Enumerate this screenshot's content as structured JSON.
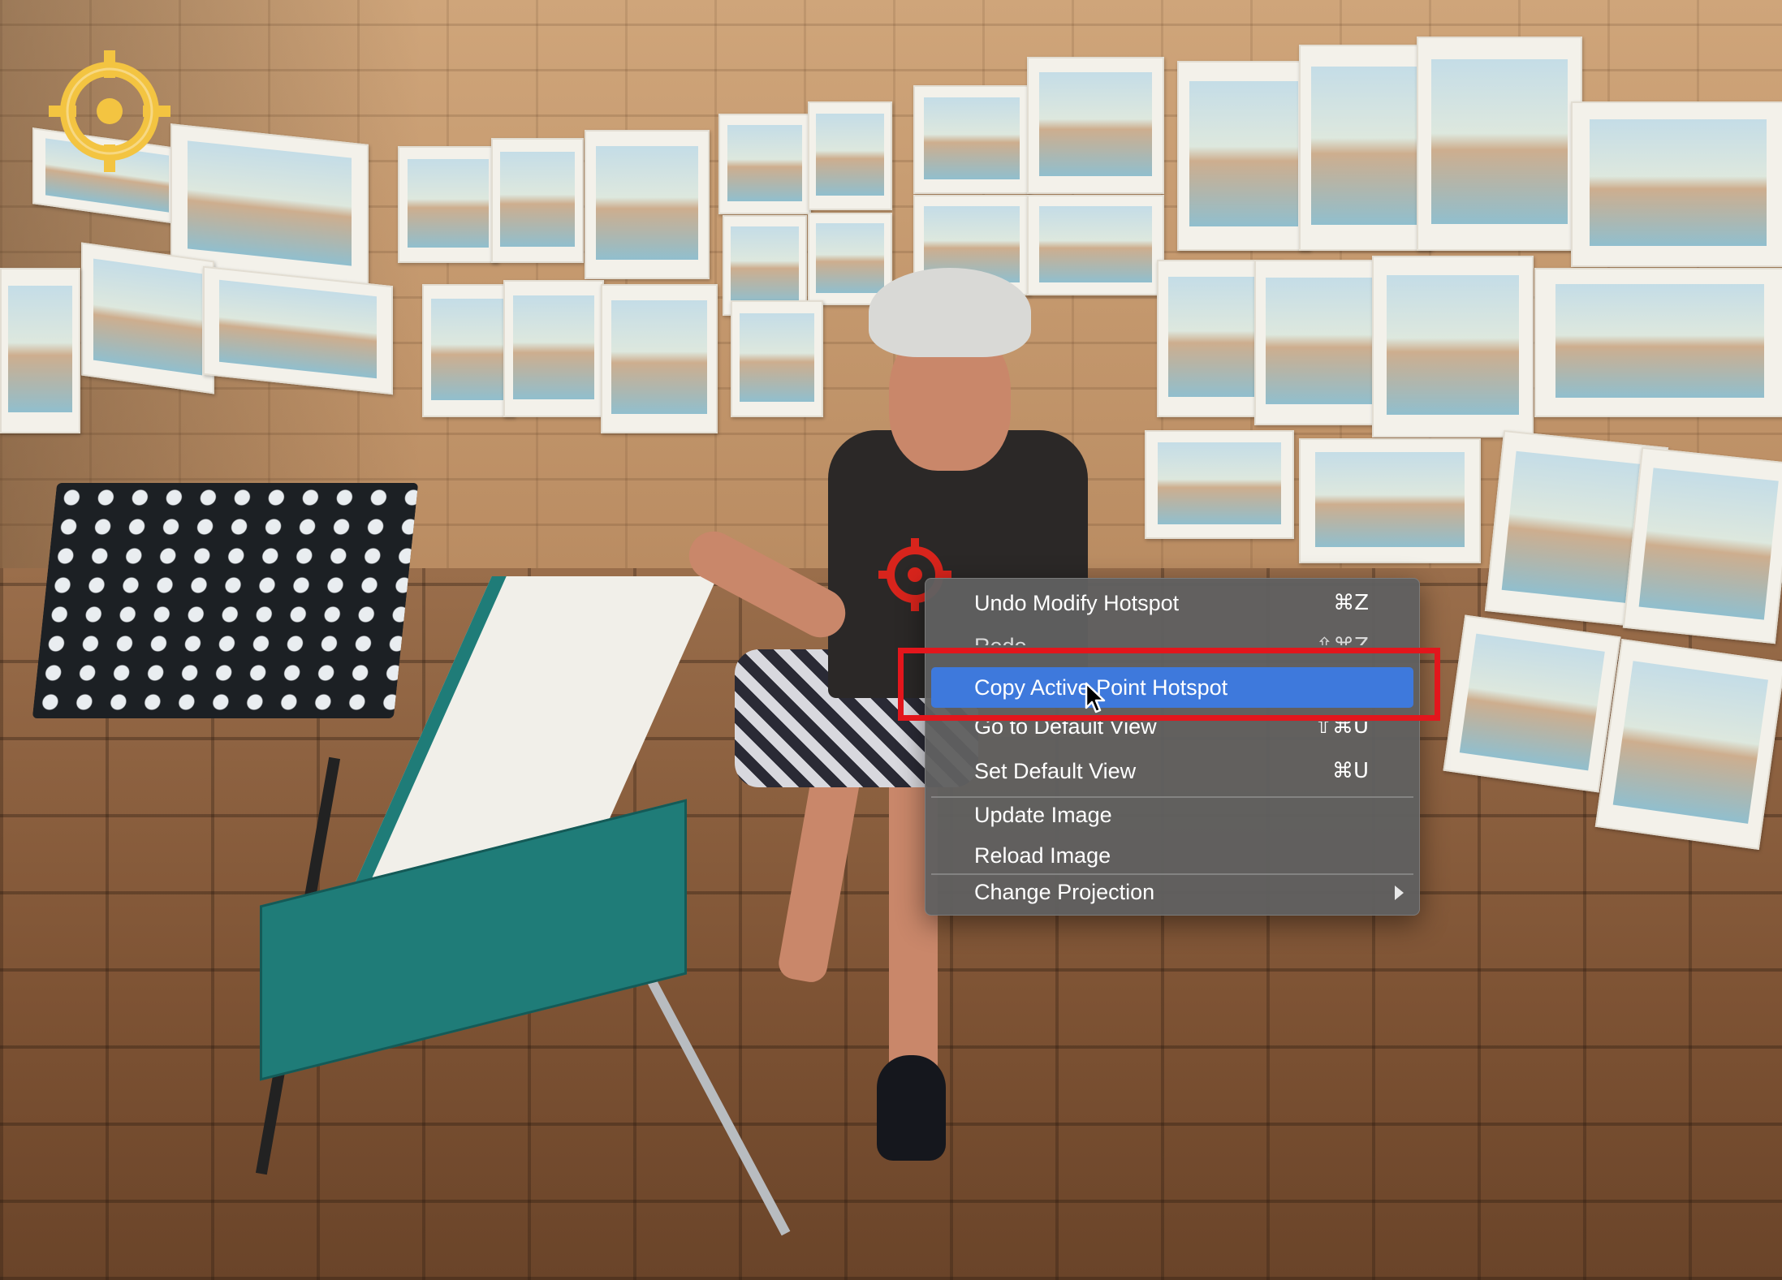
{
  "context_menu": {
    "items": [
      {
        "label": "Undo Modify Hotspot",
        "shortcut": "⌘Z",
        "state": "normal"
      },
      {
        "label": "Redo",
        "shortcut": "⇧⌘Z",
        "state": "disabled"
      },
      {
        "label": "Copy Active Point Hotspot",
        "shortcut": "",
        "state": "highlighted"
      },
      {
        "label": "Go to Default View",
        "shortcut": "⇧⌘U",
        "state": "normal"
      },
      {
        "label": "Set Default View",
        "shortcut": "⌘U",
        "state": "normal"
      },
      {
        "label": "Update Image",
        "shortcut": "",
        "state": "normal"
      },
      {
        "label": "Reload Image",
        "shortcut": "",
        "state": "normal"
      },
      {
        "label": "Change Projection",
        "shortcut": "",
        "state": "normal",
        "has_submenu": true
      }
    ]
  },
  "annotation": {
    "color": "#e3161c"
  },
  "accent_color": "#3e79dc",
  "icons": {
    "gold_hotspot": "crosshair-target-icon",
    "red_hotspot": "crosshair-target-icon",
    "cursor": "arrow-pointer-icon",
    "submenu": "chevron-right-icon"
  },
  "background": {
    "scene": "panorama-street-artist"
  }
}
